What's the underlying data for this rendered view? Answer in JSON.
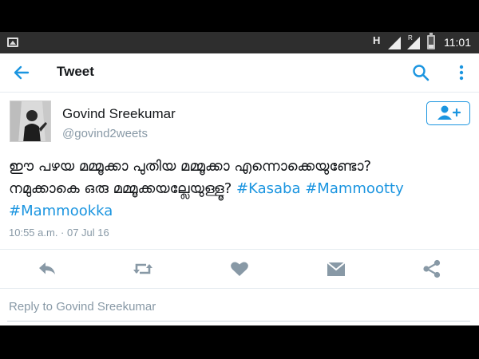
{
  "statusbar": {
    "network_type": "H",
    "roaming_indicator": "R",
    "time": "11:01",
    "icons": [
      "image-notification-icon",
      "signal-icon",
      "signal-roaming-icon",
      "battery-icon"
    ]
  },
  "appbar": {
    "title": "Tweet",
    "icons": [
      "back-arrow-icon",
      "search-icon",
      "more-vertical-icon"
    ]
  },
  "tweet": {
    "author": {
      "name": "Govind Sreekumar",
      "handle": "@govind2weets"
    },
    "text_line1": "ഈ പഴയ മമ്മൂക്കാ പുതിയ മമ്മൂക്കാ എന്നൊക്കെയുണ്ടോ?",
    "text_line2": "നമുക്കാകെ ഒരു മമ്മൂക്കയല്ലേയുള്ളൂ?",
    "hashtags": [
      "#Kasaba",
      "#Mammootty",
      "#Mammookka"
    ],
    "timestamp": "10:55 a.m. · 07 Jul 16"
  },
  "actions": [
    "reply-icon",
    "retweet-icon",
    "like-icon",
    "direct-message-icon",
    "share-icon"
  ],
  "reply": {
    "placeholder": "Reply to Govind Sreekumar"
  },
  "colors": {
    "accent": "#1b95e0",
    "action_icon": "#8899a6",
    "text": "#14171a",
    "muted": "#8899a6",
    "statusbar_bg": "#2e2e2e"
  }
}
